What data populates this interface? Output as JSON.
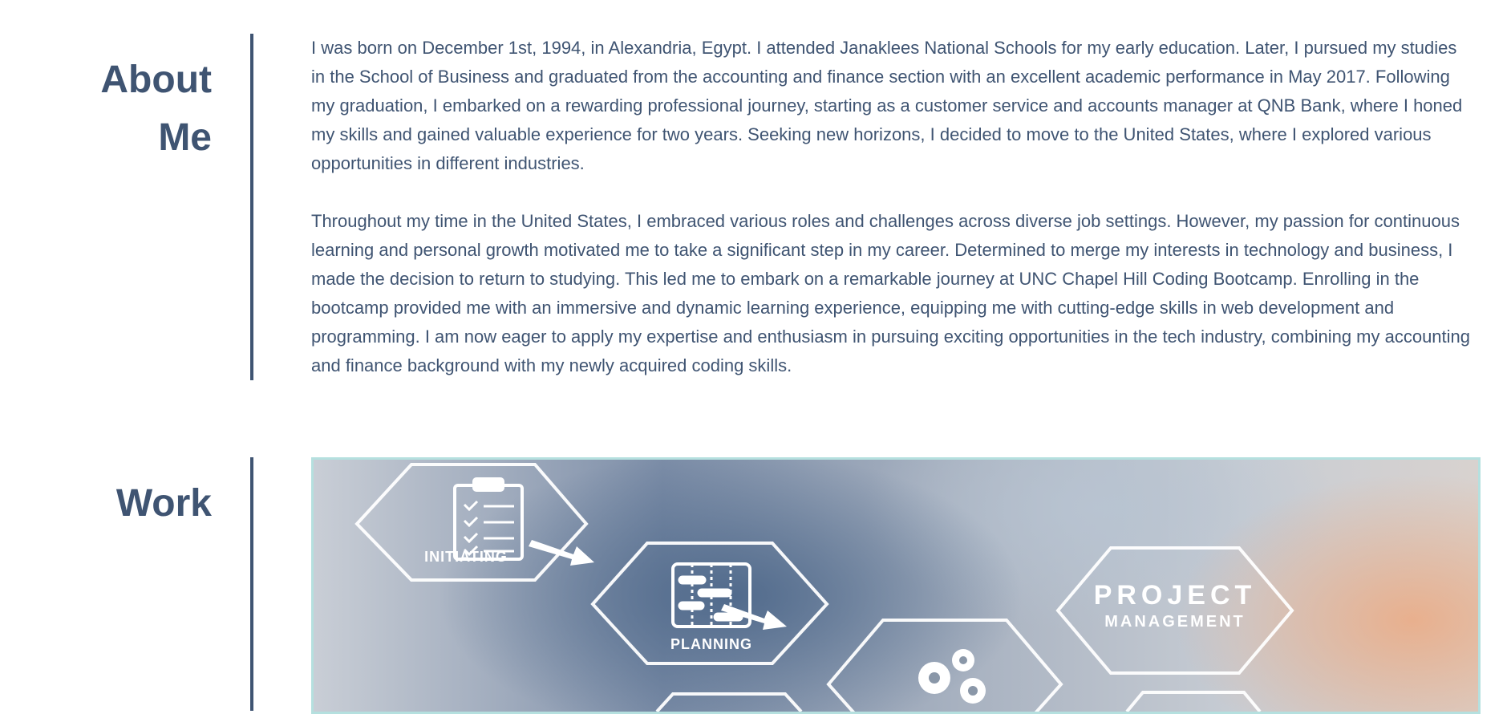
{
  "about": {
    "heading": "About Me",
    "paragraphs": [
      "I was born on December 1st, 1994, in Alexandria, Egypt. I attended Janaklees National Schools for my early education. Later, I pursued my studies in the School of Business and graduated from the accounting and finance section with an excellent academic performance in May 2017. Following my graduation, I embarked on a rewarding professional journey, starting as a customer service and accounts manager at QNB Bank, where I honed my skills and gained valuable experience for two years. Seeking new horizons, I decided to move to the United States, where I explored various opportunities in different industries.",
      "Throughout my time in the United States, I embraced various roles and challenges across diverse job settings. However, my passion for continuous learning and personal growth motivated me to take a significant step in my career. Determined to merge my interests in technology and business, I made the decision to return to studying. This led me to embark on a remarkable journey at UNC Chapel Hill Coding Bootcamp. Enrolling in the bootcamp provided me with an immersive and dynamic learning experience, equipping me with cutting-edge skills in web development and programming. I am now eager to apply my expertise and enthusiasm in pursuing exciting opportunities in the tech industry, combining my accounting and finance background with my newly acquired coding skills."
    ]
  },
  "work": {
    "heading": "Work",
    "image": {
      "labels": {
        "initiating": "INITIATING",
        "planning": "PLANNING",
        "project": "PROJECT",
        "management": "MANAGEMENT"
      },
      "icons": [
        "clipboard-checklist-icon",
        "gantt-chart-icon",
        "gears-icon",
        "arrow-icon"
      ]
    }
  },
  "colors": {
    "text": "#3f5472",
    "image_border": "#b5e0df",
    "background": "#ffffff"
  }
}
